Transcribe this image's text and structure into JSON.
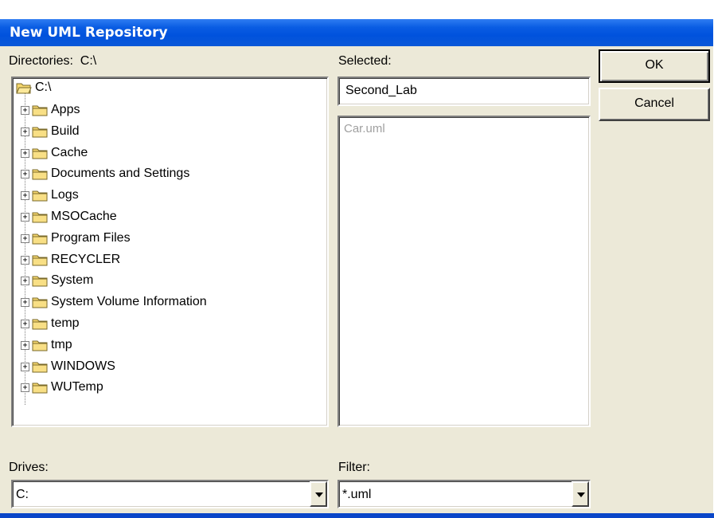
{
  "window": {
    "title": "New UML Repository"
  },
  "directories": {
    "label": "Directories:",
    "path": "C:\\",
    "root": "C:\\",
    "items": [
      {
        "label": "Apps"
      },
      {
        "label": "Build"
      },
      {
        "label": "Cache"
      },
      {
        "label": "Documents and Settings"
      },
      {
        "label": "Logs"
      },
      {
        "label": "MSOCache"
      },
      {
        "label": "Program Files"
      },
      {
        "label": "RECYCLER"
      },
      {
        "label": "System"
      },
      {
        "label": "System Volume Information"
      },
      {
        "label": "temp"
      },
      {
        "label": "tmp"
      },
      {
        "label": "WINDOWS"
      },
      {
        "label": "WUTemp"
      }
    ]
  },
  "selected": {
    "label": "Selected:",
    "value": "Second_Lab",
    "files": [
      "Car.uml"
    ]
  },
  "buttons": {
    "ok": "OK",
    "cancel": "Cancel"
  },
  "drives": {
    "label": "Drives:",
    "value": "C:"
  },
  "filter": {
    "label": "Filter:",
    "value": "*.uml"
  },
  "colors": {
    "titlebar": "#0a5de3",
    "face": "#ece9d8",
    "folder": "#f5d76e"
  }
}
